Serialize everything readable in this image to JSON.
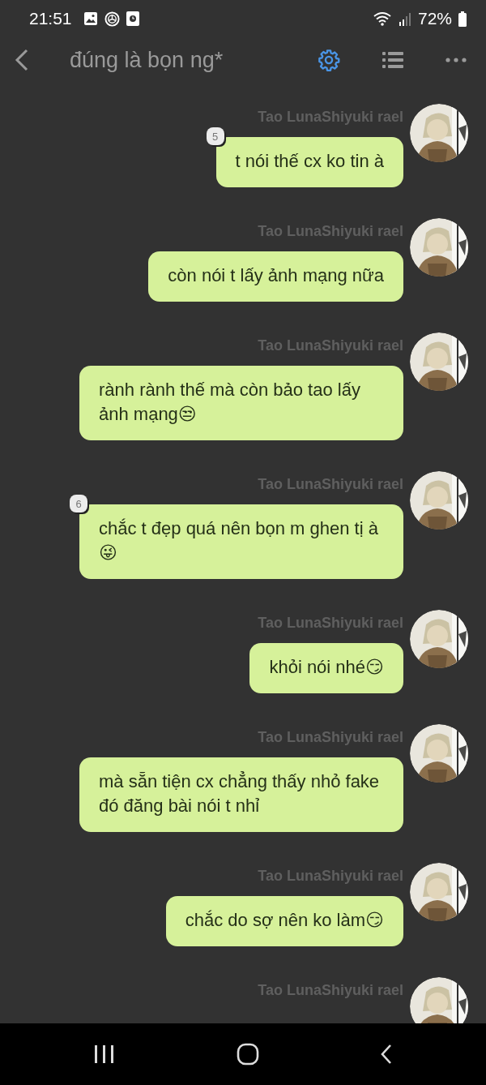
{
  "status_bar": {
    "time": "21:51",
    "battery": "72%"
  },
  "header": {
    "title": "đúng là bọn ng*"
  },
  "messages": [
    {
      "sender": "Tao LunaShiyuki rael",
      "text": "t nói thế cx ko tin à",
      "badge": "5"
    },
    {
      "sender": "Tao LunaShiyuki rael",
      "text": "còn nói t lấy ảnh mạng nữa"
    },
    {
      "sender": "Tao LunaShiyuki rael",
      "text": "rành rành thế mà còn bảo tao lấy ảnh mạng😒"
    },
    {
      "sender": "Tao LunaShiyuki rael",
      "text": "chắc t đẹp quá nên bọn m ghen tị à😜",
      "badge": "6"
    },
    {
      "sender": "Tao LunaShiyuki rael",
      "text": "khỏi nói nhé😏"
    },
    {
      "sender": "Tao LunaShiyuki rael",
      "text": "mà sẵn tiện cx chẳng thấy nhỏ fake đó đăng bài nói t nhỉ"
    },
    {
      "sender": "Tao LunaShiyuki rael",
      "text": "chắc do sợ nên ko làm😏"
    },
    {
      "sender": "Tao LunaShiyuki rael"
    }
  ]
}
